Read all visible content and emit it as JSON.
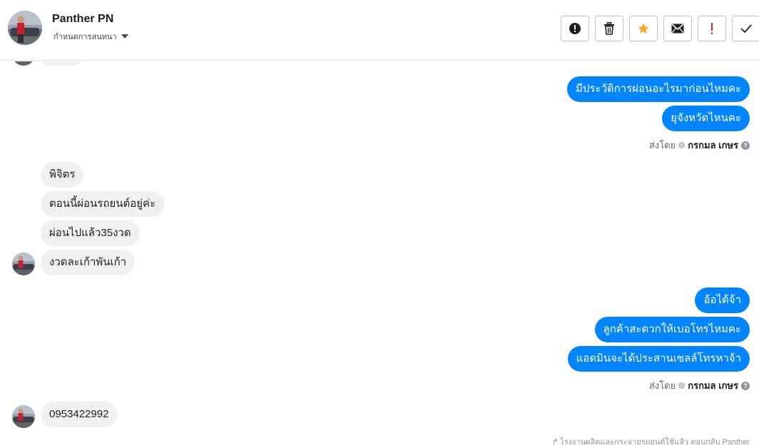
{
  "header": {
    "contact_name": "Panther PN",
    "assign_label": "กำหนดการสนทนา",
    "actions": [
      {
        "icon": "alert-circle-icon"
      },
      {
        "icon": "trash-icon"
      },
      {
        "icon": "star-icon",
        "color": "#f5a623"
      },
      {
        "icon": "envelope-icon"
      },
      {
        "icon": "exclamation-icon",
        "color": "#e02020"
      },
      {
        "icon": "checkmark-icon"
      }
    ]
  },
  "messages": {
    "group1_out": [
      "มีประวัติการผ่อนอะไรมาก่อนไหมคะ",
      "ยุจังหวัดไหนคะ"
    ],
    "group1_sent_prefix": "ส่งโดย",
    "group1_sent_by": "กรกมล เกษร",
    "group2_in": [
      "พิจิตร",
      "ตอนนี้ผ่อนรถยนต์อยู่ค่ะ",
      "ผ่อนไปแล้ว35งวด",
      "งวดละเก้าพันเก้า"
    ],
    "group3_out": [
      "อ้อได้จ้า",
      "ลูกค้าสะดวกให้เบอโทรไหมคะ",
      "แอดมินจะได้ประสานเซลล์โทรหาจ้า"
    ],
    "group3_sent_prefix": "ส่งโดย",
    "group3_sent_by": "กรกมล เกษร",
    "group4_in": [
      "0953422992"
    ]
  },
  "footer_note": "โรงงานผลิตและกระจายรถยนต์ใช้แล้ว ตอบกลับ Panther",
  "colors": {
    "outgoing_bubble": "#0084ff",
    "incoming_bubble": "#f1f0f0"
  }
}
